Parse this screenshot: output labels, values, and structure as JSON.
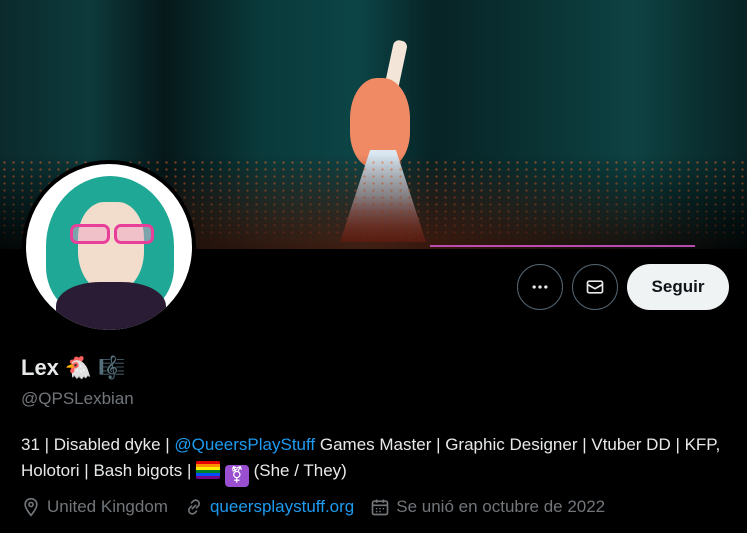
{
  "banner": {
    "description_icon": "banner-image"
  },
  "actions": {
    "more_icon": "more-horizontal-icon",
    "mail_icon": "mail-icon",
    "follow_label": "Seguir"
  },
  "profile": {
    "name": "Lex",
    "name_emoji_1": "🐔",
    "name_emoji_2": "🎼",
    "handle": "@QPSLexbian"
  },
  "bio": {
    "part1": "31 | Disabled dyke | ",
    "mention": "@QueersPlayStuff",
    "part2": " Games Master | Graphic Designer | Vtuber DD | KFP, Holotori |  Bash bigots | ",
    "part3": " (She / They)",
    "trans_symbol": "⚧"
  },
  "meta": {
    "location": "United Kingdom",
    "website": "queersplaystuff.org",
    "joined": "Se unió en octubre de 2022"
  },
  "colors": {
    "accent": "#1d9bf0",
    "muted": "#71767b",
    "text": "#e7e9ea",
    "follow_bg": "#eff3f4"
  }
}
